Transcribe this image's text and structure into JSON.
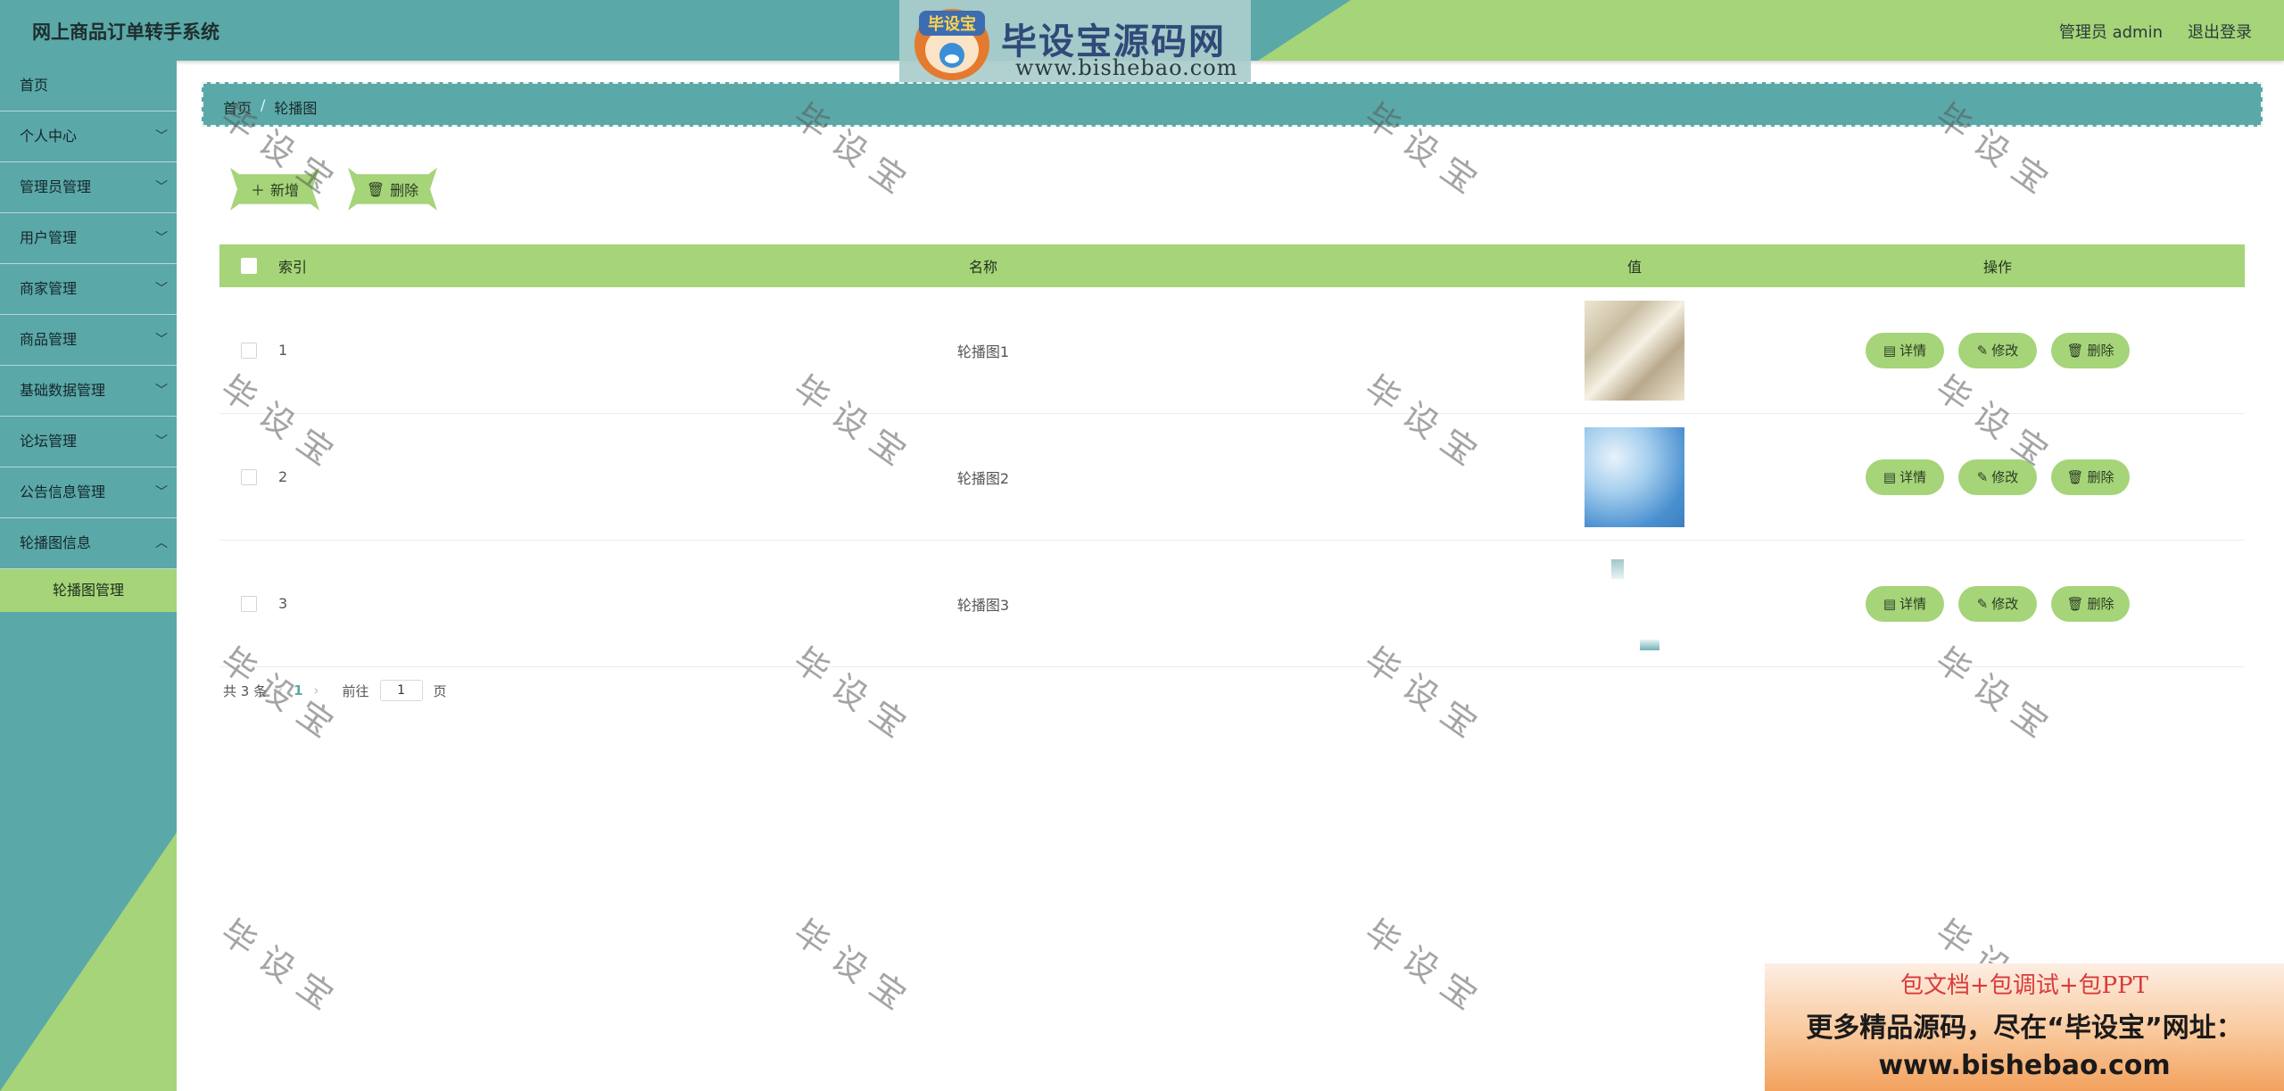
{
  "app": {
    "title": "网上商品订单转手系统",
    "admin_label": "管理员 admin",
    "logout_label": "退出登录"
  },
  "logo": {
    "badge": "毕设宝",
    "text": "毕设宝源码网",
    "url": "www.bishebao.com"
  },
  "sidebar": {
    "items": [
      {
        "label": "首页"
      },
      {
        "label": "个人中心"
      },
      {
        "label": "管理员管理"
      },
      {
        "label": "用户管理"
      },
      {
        "label": "商家管理"
      },
      {
        "label": "商品管理"
      },
      {
        "label": "基础数据管理"
      },
      {
        "label": "论坛管理"
      },
      {
        "label": "公告信息管理"
      },
      {
        "label": "轮播图信息"
      }
    ],
    "active_sub": "轮播图管理"
  },
  "breadcrumb": {
    "home": "首页",
    "current": "轮播图"
  },
  "toolbar": {
    "add_label": "新增",
    "delete_label": "删除"
  },
  "table": {
    "headers": {
      "index": "索引",
      "name": "名称",
      "value": "值",
      "actions": "操作"
    },
    "rows": [
      {
        "index": "1",
        "name": "轮播图1"
      },
      {
        "index": "2",
        "name": "轮播图2"
      },
      {
        "index": "3",
        "name": "轮播图3"
      }
    ],
    "row_actions": {
      "detail": "详情",
      "edit": "修改",
      "delete": "删除"
    }
  },
  "pagination": {
    "total": "共 3 条",
    "current_page": "1",
    "goto_label": "前往",
    "page_input": "1",
    "page_suffix": "页"
  },
  "watermark": "毕设宝",
  "ad": {
    "line1": "包文档+包调试+包PPT",
    "line2": "更多精品源码，尽在“毕设宝”网址：",
    "line3": "www.bishebao.com"
  },
  "colors": {
    "teal": "#5ba8a8",
    "green": "#a6d479"
  }
}
